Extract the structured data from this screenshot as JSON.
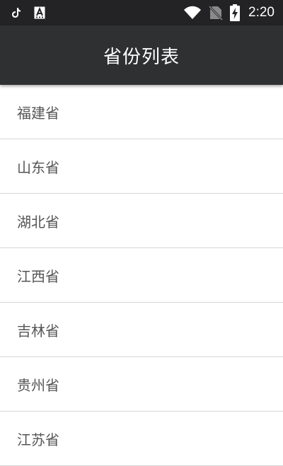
{
  "status_bar": {
    "time": "2:20",
    "icons": [
      "tiktok-icon",
      "text-a-icon",
      "wifi-icon",
      "no-sim-icon",
      "battery-charging-icon"
    ]
  },
  "app_bar": {
    "title": "省份列表"
  },
  "provinces": [
    "福建省",
    "山东省",
    "湖北省",
    "江西省",
    "吉林省",
    "贵州省",
    "江苏省"
  ],
  "colors": {
    "status_bar_bg": "#232325",
    "app_bar_bg": "#2f3032",
    "item_text": "#555555",
    "divider": "#d6d6d6"
  }
}
